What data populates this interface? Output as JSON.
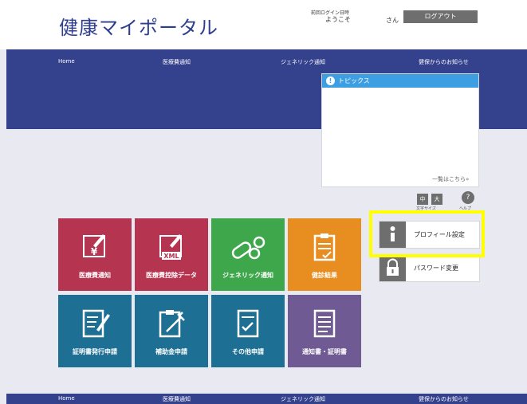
{
  "header": {
    "logo": "健康マイポータル",
    "last_login_label": "前回ログイン日時",
    "welcome": "ようこそ",
    "honorific": "さん",
    "logout_label": "ログアウト"
  },
  "nav": [
    "Home",
    "医療費通知",
    "ジェネリック通知",
    "健保からのお知らせ"
  ],
  "topics": {
    "title": "トピックス",
    "more_link": "一覧はこちら»"
  },
  "font_size": {
    "medium": "中",
    "large": "大",
    "help": "?",
    "caption_font": "文字サイズ",
    "caption_help": "ヘルプ"
  },
  "tiles": [
    {
      "label": "医療費通知",
      "color": "#b5344f"
    },
    {
      "label": "医療費控除データ",
      "color": "#b5344f"
    },
    {
      "label": "ジェネリック通知",
      "color": "#3ea74b"
    },
    {
      "label": "健診結果",
      "color": "#e88d20"
    },
    {
      "label": "証明書発行申請",
      "color": "#1d6f93"
    },
    {
      "label": "補助金申請",
      "color": "#1d6f93"
    },
    {
      "label": "その他申請",
      "color": "#1d6f93"
    },
    {
      "label": "通知書・証明書",
      "color": "#6f5a93"
    }
  ],
  "xml_badge": "XML",
  "yen_symbol": "¥",
  "side": {
    "profile_label": "プロフィール設定",
    "password_label": "パスワード変更"
  },
  "footer": [
    "Home",
    "医療費通知",
    "ジェネリック通知",
    "健保からのお知らせ"
  ],
  "colors": {
    "navy": "#34418c",
    "highlight": "#ffff00",
    "topics_blue": "#3d9fe1"
  }
}
